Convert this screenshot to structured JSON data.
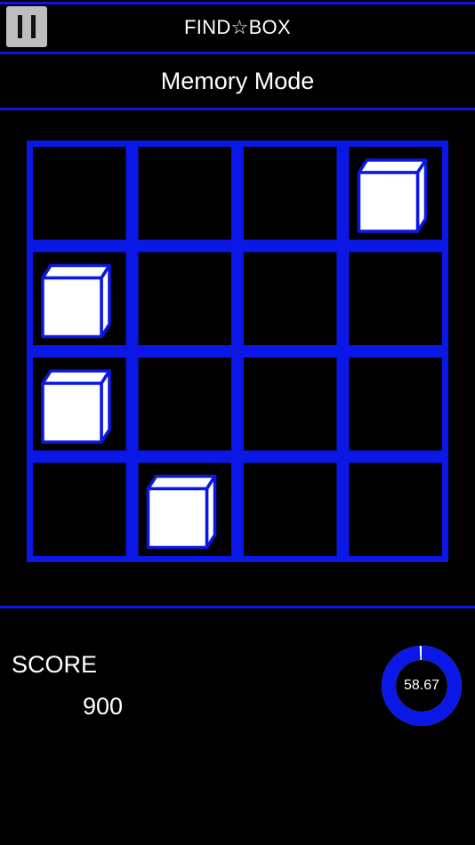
{
  "header": {
    "app_title": "FIND☆BOX",
    "pause_icon": "pause-icon"
  },
  "mode": {
    "title": "Memory Mode"
  },
  "board": {
    "rows": 4,
    "cols": 4,
    "boxes": [
      {
        "row": 0,
        "col": 3
      },
      {
        "row": 1,
        "col": 0
      },
      {
        "row": 2,
        "col": 0
      },
      {
        "row": 3,
        "col": 1
      }
    ]
  },
  "score": {
    "label": "SCORE",
    "value": "900"
  },
  "timer": {
    "text": "58.67",
    "remaining_fraction": 0.99
  },
  "colors": {
    "accent": "#0a17e6",
    "background": "#000000",
    "box": "#ffffff",
    "pause_button": "#bdbdbd"
  }
}
